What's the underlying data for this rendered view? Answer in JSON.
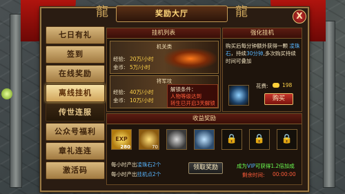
{
  "window": {
    "title": "奖励大厅",
    "close_label": "X"
  },
  "sidebar": {
    "items": [
      {
        "label": "七日有礼"
      },
      {
        "label": "签到"
      },
      {
        "label": "在线奖励"
      },
      {
        "label": "离线挂机"
      },
      {
        "label": "传世连服"
      },
      {
        "label": "公众号福利"
      },
      {
        "label": "章礼连连"
      },
      {
        "label": "激活码"
      }
    ]
  },
  "hangup_list": {
    "header": "挂机列表",
    "modes": [
      {
        "name": "机关类",
        "exp_label": "经验:",
        "exp_value": "20万/小时",
        "gold_label": "金币:",
        "gold_value": "5万/小时"
      },
      {
        "name": "将军坟",
        "exp_label": "经验:",
        "exp_value": "40万/小时",
        "gold_label": "金币:",
        "gold_value": "10万/小时",
        "unlock_title": "解锁条件：",
        "unlock_lines": [
          "人物等级达到",
          "转生已开启3天解锁"
        ]
      }
    ]
  },
  "enhance": {
    "header": "强化挂机",
    "description_line1": "购买后每分钟额外获得一颗 ",
    "description_item": "凌珠石",
    "description_line1_end": "，",
    "description_line2a": "持续",
    "description_duration": "30分钟",
    "description_line2b": ",多次购买持续时间可叠加",
    "cost_label": "花费:",
    "cost_value": "198",
    "buy_label": "购买"
  },
  "rewards": {
    "header": "收益奖励",
    "items": [
      {
        "icon": "exp-orb",
        "count": "280"
      },
      {
        "icon": "gold-pile",
        "count": "70"
      },
      {
        "icon": "stone-orb",
        "count": ""
      },
      {
        "icon": "crystal-shard",
        "count": ""
      },
      {
        "icon": "lock",
        "count": ""
      },
      {
        "icon": "lock",
        "count": ""
      },
      {
        "icon": "lock",
        "count": ""
      }
    ],
    "line1_prefix": "每小时产出",
    "line1_item": "凌珠石2个",
    "line2_prefix": "每小时产出",
    "line2_item": "挂机点2个",
    "claim_label": "领取奖励",
    "vip_prefix": "成为",
    "vip_word": "VIP",
    "vip_suffix": "可获得1.2倍加成",
    "remain_label": "剩余时间:",
    "remain_value": "00:00:00"
  },
  "colors": {
    "accent": "#ffd34a",
    "alert": "#ff5c3a",
    "good": "#6dff52",
    "vip": "#58b6ff"
  }
}
